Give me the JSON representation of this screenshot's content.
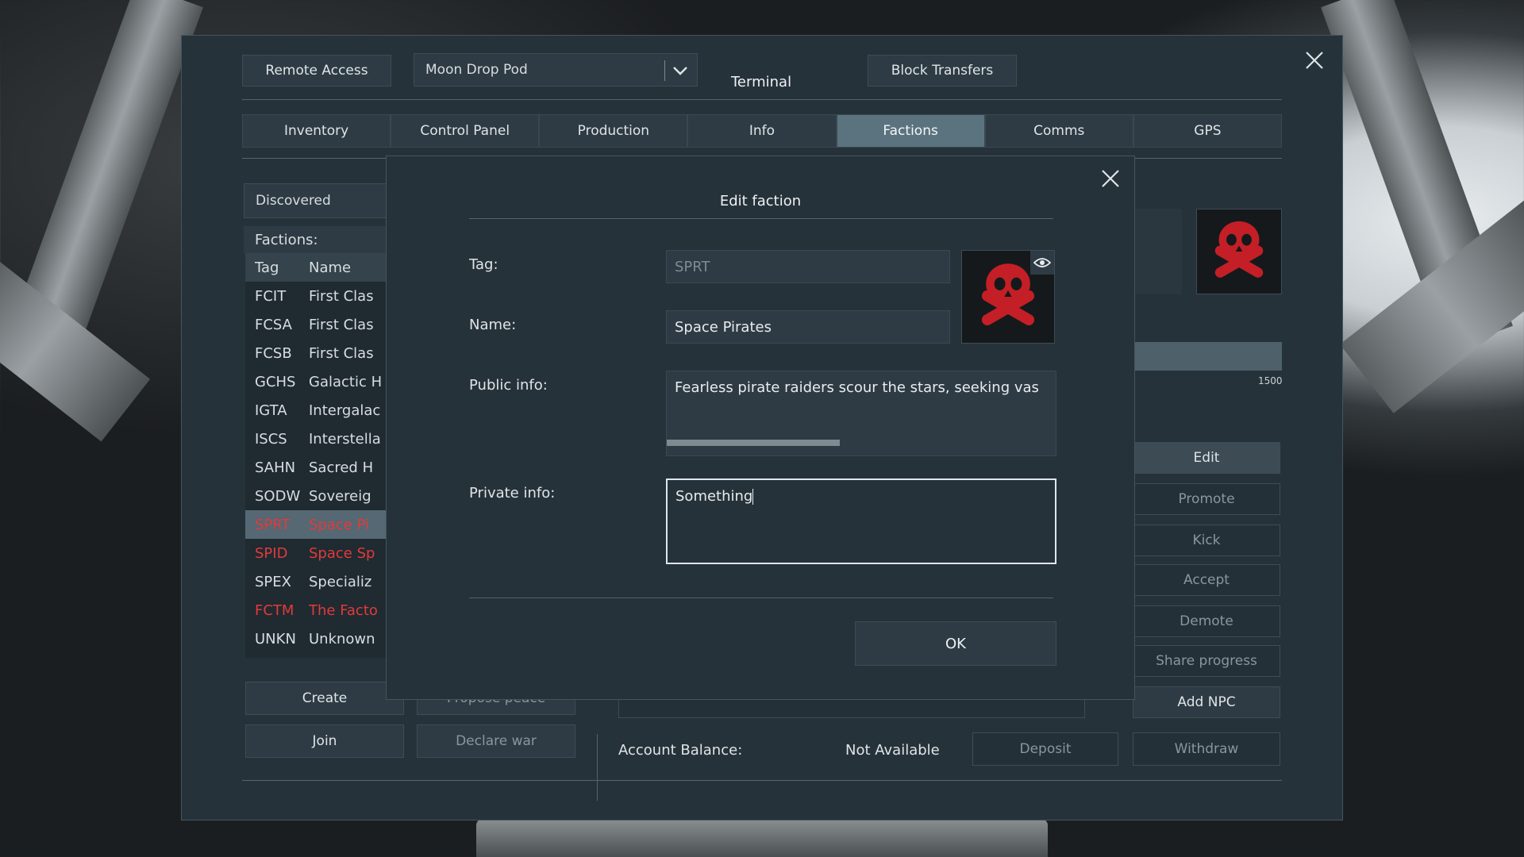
{
  "terminal": {
    "title": "Terminal",
    "remote_access": "Remote Access",
    "grid_selector": "Moon Drop Pod",
    "block_transfers": "Block Transfers",
    "tabs": [
      "Inventory",
      "Control Panel",
      "Production",
      "Info",
      "Factions",
      "Comms",
      "GPS"
    ],
    "active_tab": "Factions"
  },
  "factions_panel": {
    "filter": "Discovered",
    "label": "Factions:",
    "col_tag": "Tag",
    "col_name": "Name",
    "rows": [
      {
        "tag": "FCIT",
        "name": "First Clas"
      },
      {
        "tag": "FCSA",
        "name": "First Clas"
      },
      {
        "tag": "FCSB",
        "name": "First Clas"
      },
      {
        "tag": "GCHS",
        "name": "Galactic H"
      },
      {
        "tag": "IGTA",
        "name": "Intergalac"
      },
      {
        "tag": "ISCS",
        "name": "Interstella"
      },
      {
        "tag": "SAHN",
        "name": "Sacred H"
      },
      {
        "tag": "SODW",
        "name": "Sovereig"
      },
      {
        "tag": "SPRT",
        "name": "Space Pi"
      },
      {
        "tag": "SPID",
        "name": "Space Sp"
      },
      {
        "tag": "SPEX",
        "name": "Specializ"
      },
      {
        "tag": "FCTM",
        "name": "The Facto"
      },
      {
        "tag": "UNKN",
        "name": "Unknown"
      }
    ],
    "create": "Create",
    "join": "Join",
    "propose_peace": "Propose peace",
    "declare_war": "Declare war"
  },
  "right_panel": {
    "progress_max": "1500",
    "edit": "Edit",
    "promote": "Promote",
    "kick": "Kick",
    "accept": "Accept",
    "demote": "Demote",
    "share_progress": "Share progress",
    "add_npc": "Add NPC",
    "account_balance_label": "Account Balance:",
    "account_balance_value": "Not Available",
    "deposit": "Deposit",
    "withdraw": "Withdraw"
  },
  "modal": {
    "title": "Edit faction",
    "tag_label": "Tag:",
    "tag_value": "SPRT",
    "name_label": "Name:",
    "name_value": "Space Pirates",
    "public_label": "Public info:",
    "public_value": "Fearless pirate raiders scour the stars, seeking vas",
    "private_label": "Private info:",
    "private_value": "Something",
    "ok": "OK"
  },
  "colors": {
    "enemy_red": "#e23a3a",
    "active_tab": "#5b737f",
    "panel": "#26323a"
  }
}
